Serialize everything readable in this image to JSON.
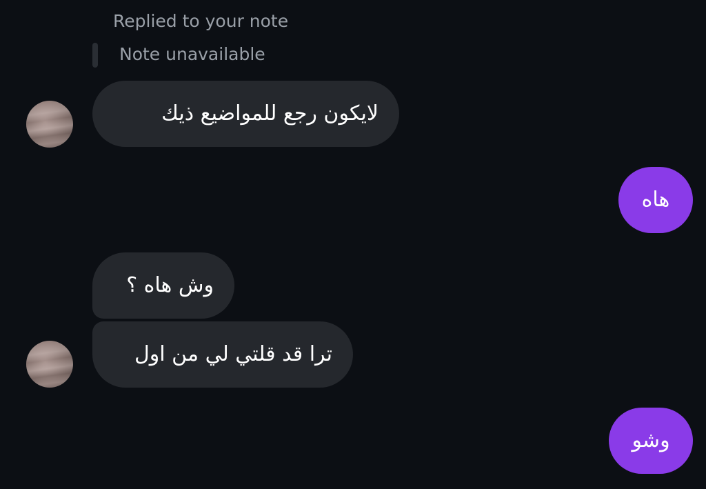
{
  "reply_context": {
    "caption": "Replied to your note",
    "quoted_note": "Note unavailable"
  },
  "messages": [
    {
      "sender": "other",
      "text": "لايكون رجع للمواضيع ذيك"
    },
    {
      "sender": "me",
      "text": "هاه"
    },
    {
      "sender": "other",
      "text": "وش هاه ؟"
    },
    {
      "sender": "other",
      "text": "ترا قد قلتي لي من اول"
    },
    {
      "sender": "me",
      "text": "وشو"
    }
  ],
  "colors": {
    "background": "#0c0f14",
    "incoming_bubble": "#25282d",
    "outgoing_bubble": "#8a3be8",
    "muted_text": "#9aa0a8"
  }
}
